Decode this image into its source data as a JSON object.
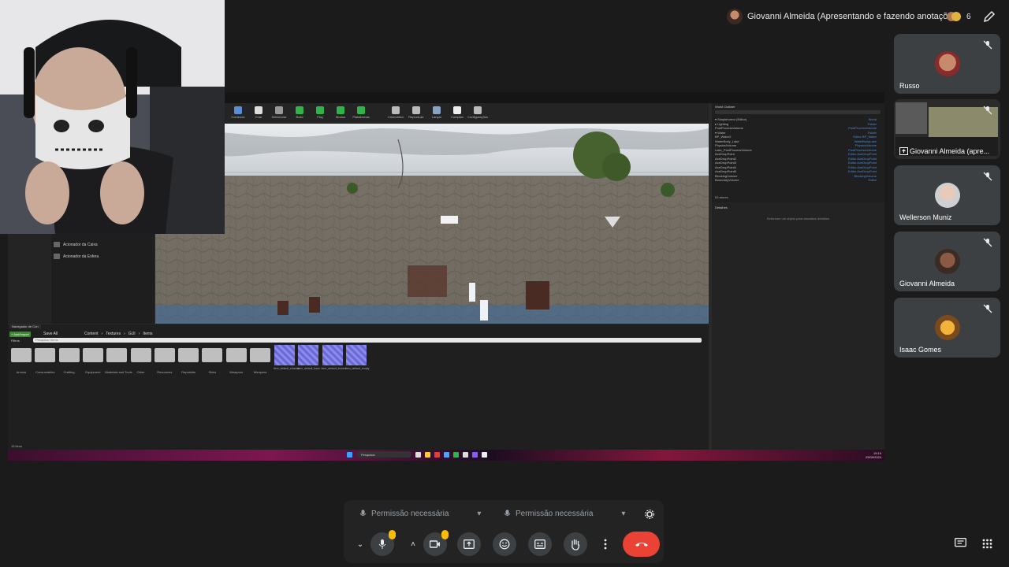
{
  "presenter": {
    "name": "Giovanni Almeida (Apresentando e fazendo anotações)",
    "people_count": "6"
  },
  "participants": [
    {
      "name": "Russo"
    },
    {
      "name": "Giovanni Almeida (apre..."
    },
    {
      "name": "Wellerson Muniz"
    },
    {
      "name": "Giovanni Almeida"
    },
    {
      "name": "Isaac Gomes"
    }
  ],
  "controls": {
    "mic_permission": "Permissão necessária",
    "cam_permission": "Permissão necessária"
  },
  "shared_screen": {
    "toolbar": [
      "Conteúdo",
      "Criar",
      "Selecionar",
      "Build",
      "Play",
      "Modos",
      "Plataformas",
      "Cinemático",
      "Reproduzir",
      "Lançar",
      "Compilar",
      "Configurações"
    ],
    "left_panel_items": [
      "Acionador da Caixa",
      "Acionador da Esfera"
    ],
    "outliner_title": "World Outliner",
    "outliner_rows": [
      {
        "label": "▾ Simplehorror (Editor)",
        "type": "World"
      },
      {
        "label": "  ▸ Lighting",
        "type": "Folder"
      },
      {
        "label": "    PostProcessVolume",
        "type": "PostProcessVolume"
      },
      {
        "label": "  ▾ Water",
        "type": "Folder"
      },
      {
        "label": "    BP_Water2",
        "type": "Editor BP_Water"
      },
      {
        "label": "    WaterBody_Lake",
        "type": "WaterBodyLake"
      },
      {
        "label": "    PhysicsVolume",
        "type": "PhysicsVolume"
      },
      {
        "label": "    Lake_PostProcessVolume",
        "type": "PostProcessVolume"
      },
      {
        "label": "  AxeDropPoint",
        "type": "Editor AxeDropPoint"
      },
      {
        "label": "  AxeDropPoint2",
        "type": "Editor AxeDropPoint"
      },
      {
        "label": "  AxeDropPoint3",
        "type": "Editor AxeDropPoint"
      },
      {
        "label": "  AxeDropPoint4",
        "type": "Editor AxeDropPoint"
      },
      {
        "label": "  AxeDropPoint5",
        "type": "Editor AxeDropPoint"
      },
      {
        "label": "  BlockingVolume",
        "type": "BlockingVolume"
      },
      {
        "label": "  BoundaryVolume",
        "type": "Editor"
      }
    ],
    "outliner_footer": "63 atores",
    "details_title": "Detalhes",
    "details_hint": "Selecione um objeto para visualizar detalhes",
    "content_browser": {
      "tab": "Navegador de Con",
      "add_button": "+ Add/Import",
      "save_all": "Save All",
      "breadcrumb": [
        "Content",
        "Textures",
        "GUI",
        "Items"
      ],
      "filters": "Filtros",
      "search_placeholder": "Pesquisar Items",
      "folders": [
        "Arrows",
        "Consumables",
        "Crafting",
        "Equipment",
        "Materials and Tools",
        "Other",
        "Resources",
        "Repairkits",
        "Skins",
        "Weapons",
        "Weapons"
      ],
      "assets": [
        "item_default_shadow",
        "item_default_base",
        "item_default_locked",
        "item_default_empty"
      ],
      "status": "15 itens"
    },
    "taskbar": {
      "search": "Pesquisar",
      "time": "19:19",
      "date": "29/09/2024"
    }
  }
}
